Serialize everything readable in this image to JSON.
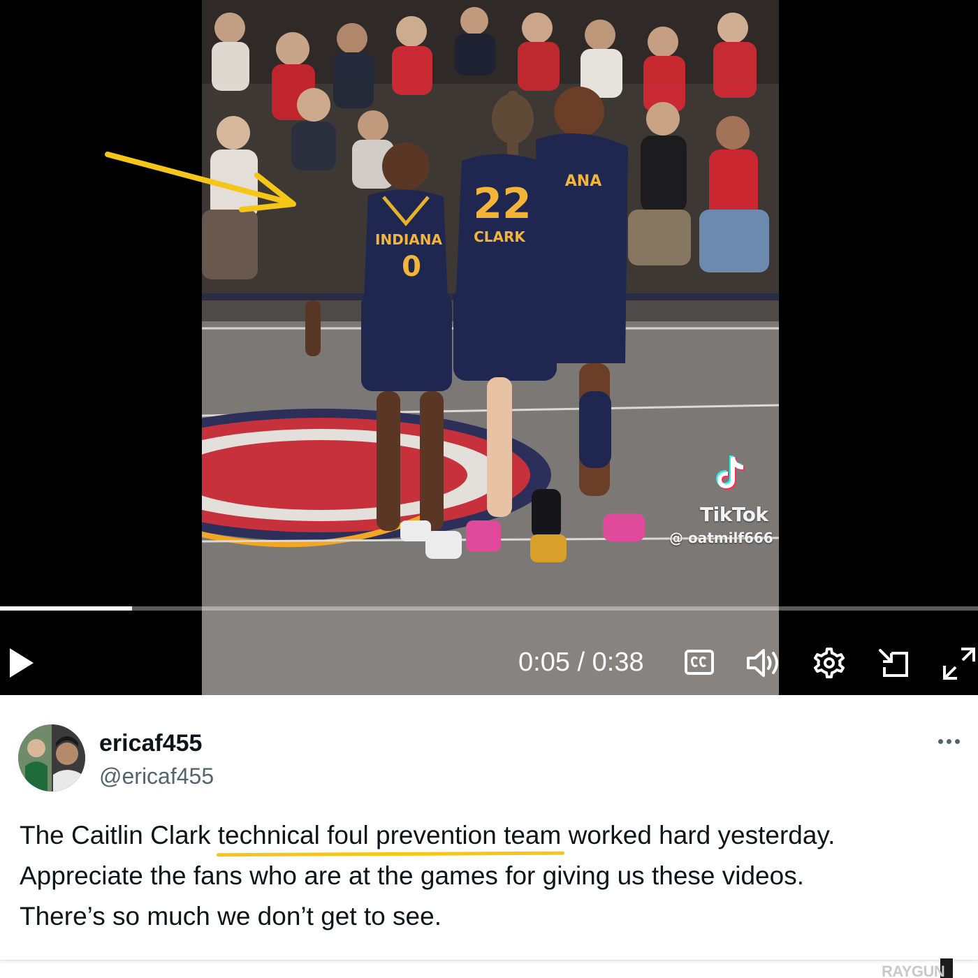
{
  "video": {
    "current_time": "0:05",
    "separator": "/",
    "duration": "0:38",
    "progress": 0.135,
    "overlay": {
      "brand": "TikTok",
      "handle": "@ oatmilf666"
    },
    "scene_text": {
      "jersey_left_team": "INDIANA",
      "jersey_left_number": "0",
      "jersey_center_number": "22",
      "jersey_center_name": "CLARK",
      "jersey_right_team": "ANA"
    },
    "controls": {
      "play_icon": "play-icon",
      "cc_icon": "closed-captions-icon",
      "volume_icon": "volume-icon",
      "settings_icon": "gear-icon",
      "pip_icon": "picture-in-picture-icon",
      "fullscreen_icon": "fullscreen-icon"
    },
    "annotation_color": "#f5c518"
  },
  "post": {
    "display_name": "ericaf455",
    "handle": "@ericaf455",
    "more_icon": "more-options-icon",
    "text": {
      "part1": "The Caitlin Clark ",
      "highlight": "technical foul prevention team",
      "part2": " worked hard yesterday.",
      "line2": "Appreciate the fans who are at the games for giving us these videos.",
      "line3": "There’s so much we don’t get to see."
    }
  },
  "watermark": "RAYGUN"
}
